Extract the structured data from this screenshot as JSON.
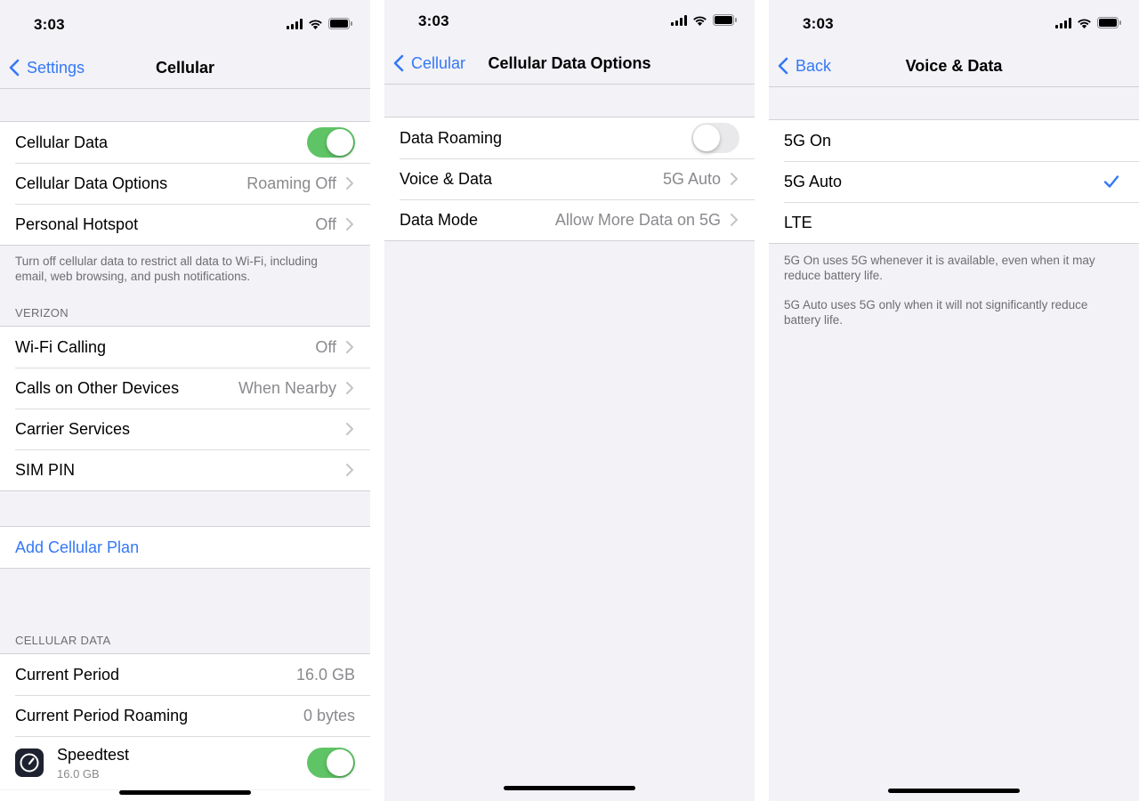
{
  "colors": {
    "accent": "#3478f6",
    "toggle_on": "#5fc466",
    "toggle_off": "#e9e9eb",
    "secondary_text": "#8a8a8e"
  },
  "status": {
    "time": "3:03"
  },
  "panel1": {
    "nav": {
      "back": "Settings",
      "title": "Cellular"
    },
    "main_rows": [
      {
        "label": "Cellular Data",
        "toggle": "on"
      },
      {
        "label": "Cellular Data Options",
        "value": "Roaming Off"
      },
      {
        "label": "Personal Hotspot",
        "value": "Off"
      }
    ],
    "footnote": "Turn off cellular data to restrict all data to Wi-Fi, including email, web browsing, and push notifications.",
    "carrier_header": "VERIZON",
    "carrier_rows": [
      {
        "label": "Wi-Fi Calling",
        "value": "Off"
      },
      {
        "label": "Calls on Other Devices",
        "value": "When Nearby"
      },
      {
        "label": "Carrier Services",
        "value": ""
      },
      {
        "label": "SIM PIN",
        "value": ""
      }
    ],
    "add_plan": "Add Cellular Plan",
    "data_header": "CELLULAR DATA",
    "usage_rows": [
      {
        "label": "Current Period",
        "value": "16.0 GB"
      },
      {
        "label": "Current Period Roaming",
        "value": "0 bytes"
      }
    ],
    "app": {
      "name": "Speedtest",
      "usage": "16.0 GB",
      "toggle": "on",
      "icon": "speedometer-icon"
    }
  },
  "panel2": {
    "nav": {
      "back": "Cellular",
      "title": "Cellular Data Options"
    },
    "rows": [
      {
        "label": "Data Roaming",
        "toggle": "off"
      },
      {
        "label": "Voice & Data",
        "value": "5G Auto"
      },
      {
        "label": "Data Mode",
        "value": "Allow More Data on 5G"
      }
    ]
  },
  "panel3": {
    "nav": {
      "back": "Back",
      "title": "Voice & Data"
    },
    "options": [
      {
        "label": "5G On",
        "selected": false
      },
      {
        "label": "5G Auto",
        "selected": true
      },
      {
        "label": "LTE",
        "selected": false
      }
    ],
    "note1": "5G On uses 5G whenever it is available, even when it may reduce battery life.",
    "note2": "5G Auto uses 5G only when it will not significantly reduce battery life."
  }
}
